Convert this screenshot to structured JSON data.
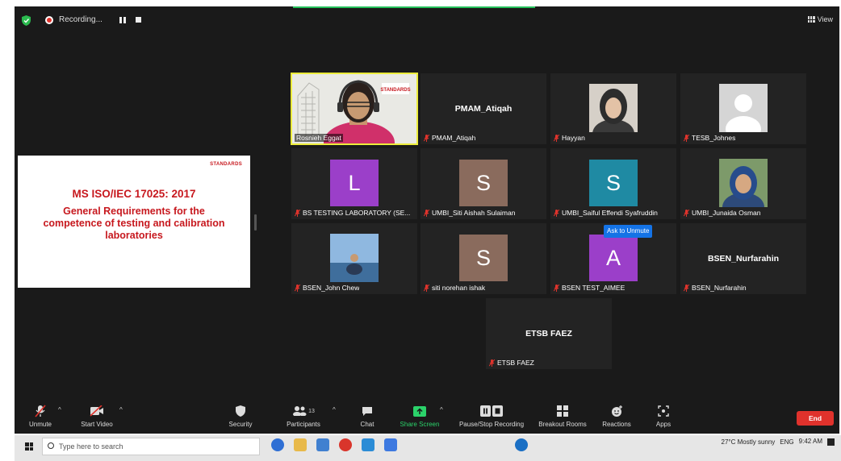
{
  "topbar": {
    "recording_label": "Recording...",
    "view_label": "View"
  },
  "slide": {
    "logo_text": "STANDARDS",
    "title": "MS ISO/IEC 17025: 2017",
    "subtitle": "General Requirements for the competence of testing and calibration laboratories"
  },
  "tiles": [
    {
      "name": "Rosnieh Eggat",
      "kind": "video",
      "active": true
    },
    {
      "name": "PMAM_Atiqah",
      "kind": "name",
      "label": "PMAM_Atiqah"
    },
    {
      "name": "Hayyan",
      "kind": "photo"
    },
    {
      "name": "TESB_Johnes",
      "kind": "avatar"
    },
    {
      "name": "BS TESTING LABORATORY (SE...",
      "kind": "initial",
      "initial": "L",
      "color": "#9b3fc9"
    },
    {
      "name": "UMBI_Siti Aishah Sulaiman",
      "kind": "initial",
      "initial": "S",
      "color": "#8a6b5d"
    },
    {
      "name": "UMBI_Saiful Effendi Syafruddin",
      "kind": "initial",
      "initial": "S",
      "color": "#1f8aa3"
    },
    {
      "name": "UMBI_Junaida Osman",
      "kind": "photo"
    },
    {
      "name": "BSEN_John Chew",
      "kind": "photo"
    },
    {
      "name": "siti norehan ishak",
      "kind": "initial",
      "initial": "S",
      "color": "#8a6b5d"
    },
    {
      "name": "BSEN TEST_AIMEE",
      "kind": "initial",
      "initial": "A",
      "color": "#9b3fc9"
    },
    {
      "name": "BSEN_Nurfarahin",
      "kind": "name",
      "label": "BSEN_Nurfarahin"
    },
    {
      "name": "ETSB FAEZ",
      "kind": "name",
      "label": "ETSB FAEZ"
    }
  ],
  "ask_to_unmute": "Ask to Unmute",
  "toolbar": {
    "unmute": "Unmute",
    "start_video": "Start Video",
    "security": "Security",
    "participants": "Participants",
    "participants_count": "13",
    "chat": "Chat",
    "share_screen": "Share Screen",
    "pause_stop_recording": "Pause/Stop Recording",
    "breakout_rooms": "Breakout Rooms",
    "reactions": "Reactions",
    "apps": "Apps",
    "end": "End"
  },
  "taskbar": {
    "search_placeholder": "Type here to search",
    "weather": "27°C Mostly sunny",
    "lang": "ENG",
    "time": "9:42 AM"
  },
  "colors": {
    "accent_green": "#24c05a",
    "active_speaker": "#ecec3b",
    "end_red": "#e0322c",
    "unmute_blue": "#1473e6"
  }
}
